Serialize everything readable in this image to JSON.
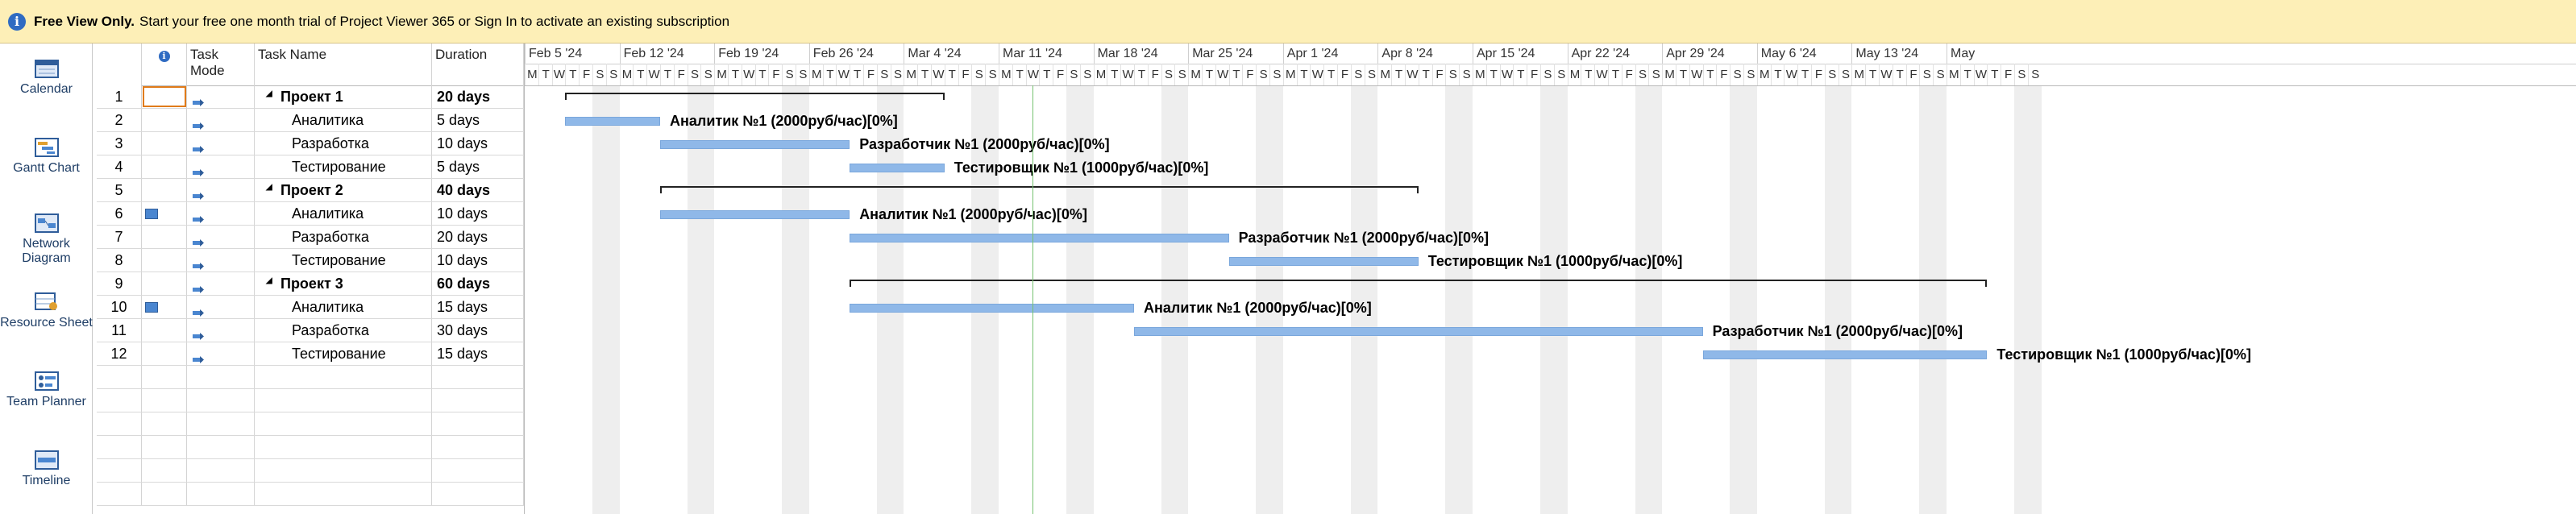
{
  "banner": {
    "bold": "Free View Only.",
    "text": "Start your free one month trial of Project Viewer 365 or Sign In to activate an existing subscription"
  },
  "views": [
    {
      "label": "Calendar",
      "icon": "calendar-icon"
    },
    {
      "label": "Gantt Chart",
      "icon": "gantt-chart-icon"
    },
    {
      "label": "Network Diagram",
      "icon": "network-diagram-icon"
    },
    {
      "label": "Resource Sheet",
      "icon": "resource-sheet-icon"
    },
    {
      "label": "Team Planner",
      "icon": "team-planner-icon"
    },
    {
      "label": "Timeline",
      "icon": "timeline-icon"
    }
  ],
  "grid": {
    "headers": {
      "indicator": "info-icon",
      "mode": "Task Mode",
      "name": "Task Name",
      "duration": "Duration"
    },
    "tasks": [
      {
        "id": "1",
        "name": "Проект 1",
        "duration": "20 days",
        "summary": true
      },
      {
        "id": "2",
        "name": "Аналитика",
        "duration": "5 days"
      },
      {
        "id": "3",
        "name": "Разработка",
        "duration": "10 days"
      },
      {
        "id": "4",
        "name": "Тестирование",
        "duration": "5 days"
      },
      {
        "id": "5",
        "name": "Проект 2",
        "duration": "40 days",
        "summary": true
      },
      {
        "id": "6",
        "name": "Аналитика",
        "duration": "10 days",
        "indicator": true
      },
      {
        "id": "7",
        "name": "Разработка",
        "duration": "20 days"
      },
      {
        "id": "8",
        "name": "Тестирование",
        "duration": "10 days"
      },
      {
        "id": "9",
        "name": "Проект 3",
        "duration": "60 days",
        "summary": true
      },
      {
        "id": "10",
        "name": "Аналитика",
        "duration": "15 days",
        "indicator": true
      },
      {
        "id": "11",
        "name": "Разработка",
        "duration": "30 days"
      },
      {
        "id": "12",
        "name": "Тестирование",
        "duration": "15 days"
      }
    ]
  },
  "timescale": {
    "weeks": [
      "Feb 5 '24",
      "Feb 12 '24",
      "Feb 19 '24",
      "Feb 26 '24",
      "Mar 4 '24",
      "Mar 11 '24",
      "Mar 18 '24",
      "Mar 25 '24",
      "Apr 1 '24",
      "Apr 8 '24",
      "Apr 15 '24",
      "Apr 22 '24",
      "Apr 29 '24",
      "May 6 '24",
      "May 13 '24",
      "May"
    ],
    "days": [
      "M",
      "T",
      "W",
      "T",
      "F",
      "S",
      "S"
    ]
  },
  "gantt": {
    "bars": [
      {
        "row": 0,
        "start": "2024-02-08",
        "end": "2024-03-06",
        "summary": true
      },
      {
        "row": 1,
        "start": "2024-02-08",
        "end": "2024-02-14",
        "label": "Аналитик №1 (2000руб/час)[0%]"
      },
      {
        "row": 2,
        "start": "2024-02-15",
        "end": "2024-02-28",
        "label": "Разработчик №1 (2000руб/час)[0%]"
      },
      {
        "row": 3,
        "start": "2024-02-29",
        "end": "2024-03-06",
        "label": "Тестировщик №1 (1000руб/час)[0%]"
      },
      {
        "row": 4,
        "start": "2024-02-15",
        "end": "2024-04-10",
        "summary": true
      },
      {
        "row": 5,
        "start": "2024-02-15",
        "end": "2024-02-28",
        "label": "Аналитик №1 (2000руб/час)[0%]"
      },
      {
        "row": 6,
        "start": "2024-02-29",
        "end": "2024-03-27",
        "label": "Разработчик №1 (2000руб/час)[0%]"
      },
      {
        "row": 7,
        "start": "2024-03-28",
        "end": "2024-04-10",
        "label": "Тестировщик №1 (1000руб/час)[0%]"
      },
      {
        "row": 8,
        "start": "2024-02-29",
        "end": "2024-05-22",
        "summary": true
      },
      {
        "row": 9,
        "start": "2024-02-29",
        "end": "2024-03-20",
        "label": "Аналитик №1 (2000руб/час)[0%]"
      },
      {
        "row": 10,
        "start": "2024-03-21",
        "end": "2024-05-01",
        "label": "Разработчик №1 (2000руб/час)[0%]"
      },
      {
        "row": 11,
        "start": "2024-05-02",
        "end": "2024-05-22",
        "label": "Тестировщик №1 (1000руб/час)[0%]"
      }
    ],
    "today": "2024-03-13"
  },
  "colors": {
    "banner_bg": "#fdefb7",
    "bar": "#8fb8e8",
    "today_line": "#74c26f",
    "selection": "#e07b1a"
  }
}
